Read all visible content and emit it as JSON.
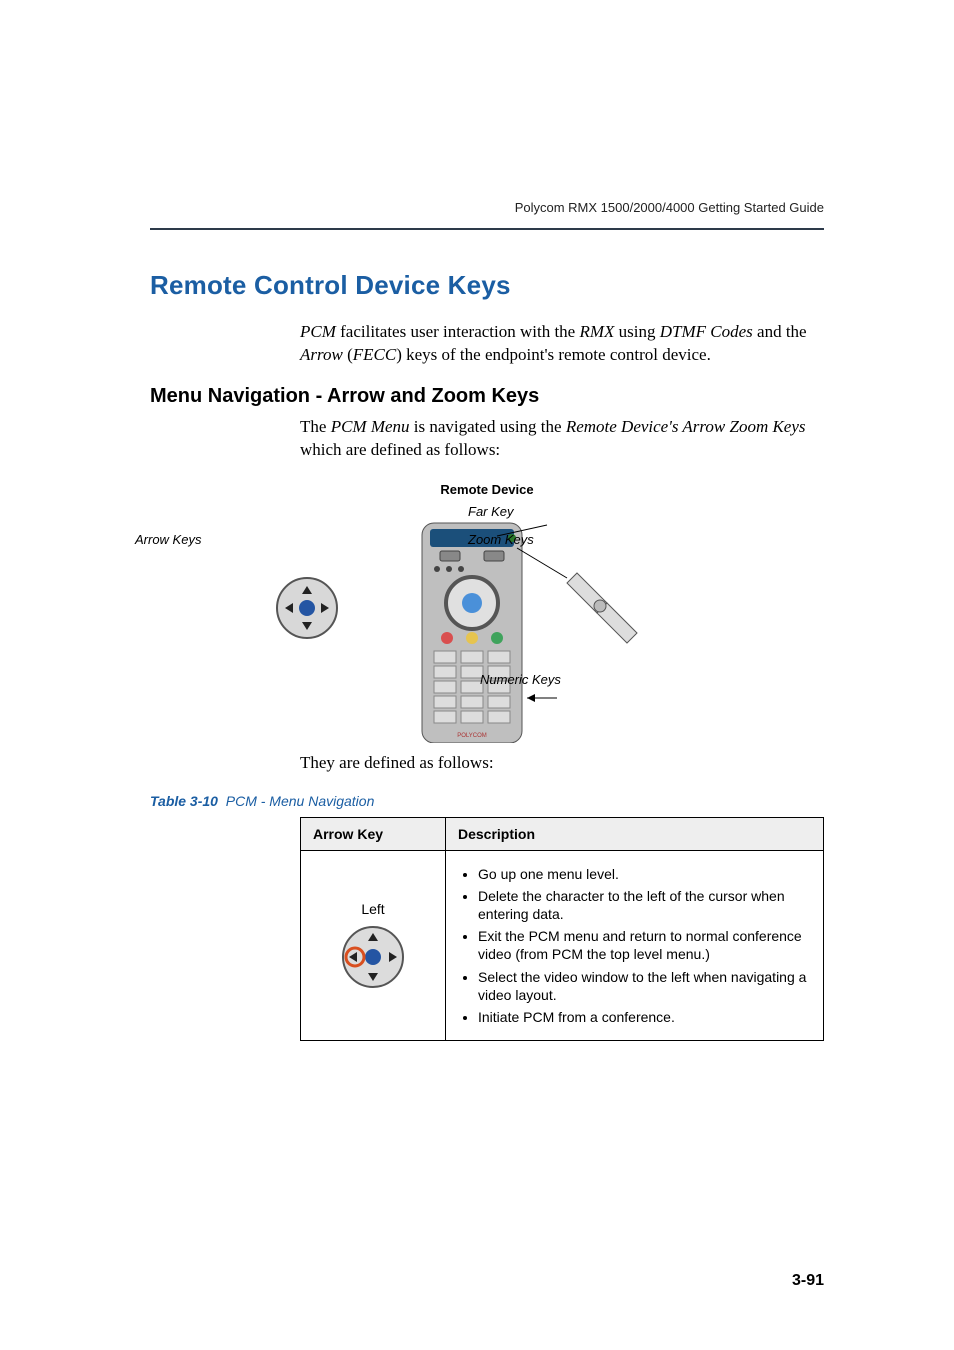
{
  "header": {
    "running": "Polycom RMX 1500/2000/4000 Getting Started Guide"
  },
  "section": {
    "heading": "Remote Control Device Keys",
    "intro_html": "<i>PCM</i> facilitates user interaction with the <i>RMX</i> using <i>DTMF Codes</i> and the <i>Arrow</i> (<i>FECC</i>) keys of the endpoint's remote control device."
  },
  "subsection": {
    "heading": "Menu Navigation - Arrow and Zoom Keys",
    "intro_html": "The <i>PCM Menu</i> is navigated using the <i>Remote Device's Arrow Zoom Keys</i> which are defined as follows:"
  },
  "figure": {
    "title": "Remote Device",
    "labels": {
      "arrow_keys": "Arrow Keys",
      "far_key": "Far Key",
      "zoom_keys": "Zoom Keys",
      "numeric_keys": "Numeric Keys"
    }
  },
  "post_figure_text": "They are defined as follows:",
  "table": {
    "caption_num": "Table 3-10",
    "caption_title": "PCM - Menu Navigation",
    "headers": {
      "col1": "Arrow Key",
      "col2": "Description"
    },
    "rows": [
      {
        "key_name": "Left",
        "descriptions": [
          "Go up one menu level.",
          "Delete the character to the left of the cursor when entering data.",
          "Exit the PCM menu and return to normal conference video (from PCM the top level menu.)",
          "Select the video window to the left when navigating a video layout.",
          "Initiate PCM from a conference."
        ]
      }
    ]
  },
  "page_number": "3-91"
}
